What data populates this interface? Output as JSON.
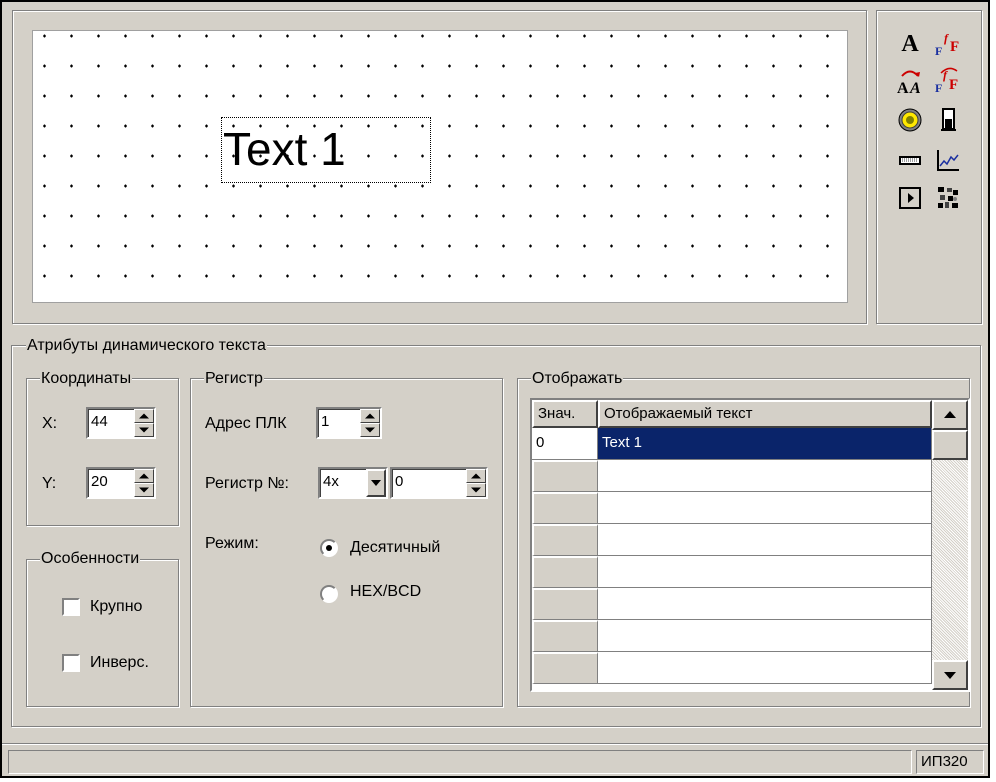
{
  "canvas": {
    "text_item": "Text 1"
  },
  "toolbox": {
    "tools": [
      "static-text",
      "font-text",
      "dynamic-text",
      "dynamic-font-text",
      "lamp",
      "bar-indicator",
      "numeric-display",
      "trend-graph",
      "button",
      "bitmap"
    ]
  },
  "attributes": {
    "title": "Атрибуты динамического текста",
    "coords": {
      "title": "Координаты",
      "x_label": "X:",
      "x_value": "44",
      "y_label": "Y:",
      "y_value": "20"
    },
    "register": {
      "title": "Регистр",
      "plc_label": "Адрес ПЛК",
      "plc_value": "1",
      "reg_label": "Регистр №:",
      "reg_type": "4x",
      "reg_value": "0",
      "mode_label": "Режим:",
      "mode_decimal": "Десятичный",
      "mode_hex": "HEX/BCD",
      "mode_selected": "decimal"
    },
    "features": {
      "title": "Особенности",
      "large_label": "Крупно",
      "large_checked": false,
      "invert_label": "Инверс.",
      "invert_checked": false
    },
    "display": {
      "title": "Отображать",
      "col_value": "Знач.",
      "col_text": "Отображаемый текст",
      "rows": [
        {
          "value": "0",
          "text": "Text 1"
        },
        {
          "value": "",
          "text": ""
        },
        {
          "value": "",
          "text": ""
        },
        {
          "value": "",
          "text": ""
        },
        {
          "value": "",
          "text": ""
        },
        {
          "value": "",
          "text": ""
        },
        {
          "value": "",
          "text": ""
        },
        {
          "value": "",
          "text": ""
        }
      ]
    }
  },
  "status": {
    "device": "ИП320"
  },
  "colors": {
    "face": "#d4d0c8",
    "selection": "#0a246a"
  }
}
